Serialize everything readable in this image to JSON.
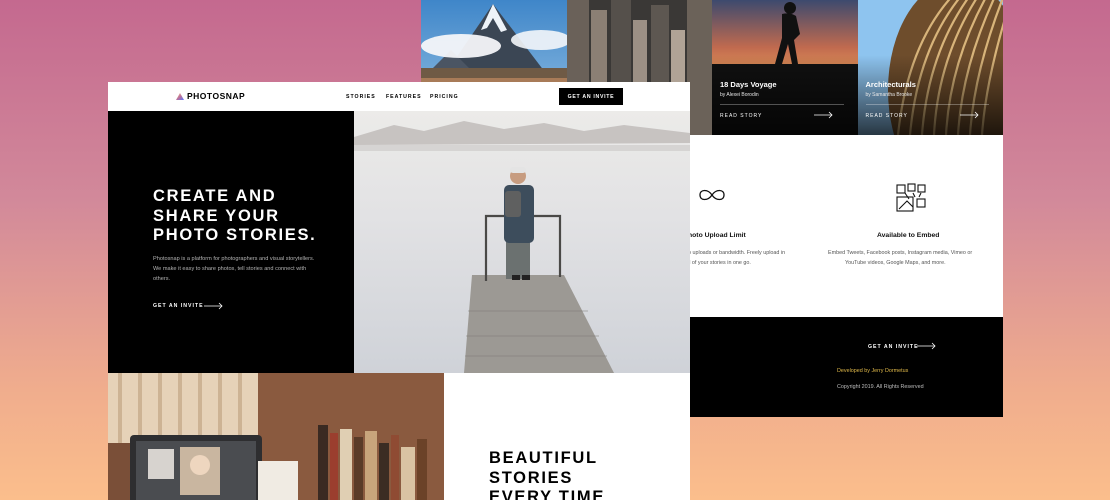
{
  "colors": {
    "accent_gradient": [
      "#ffc593",
      "#bc7198",
      "#5a77ff"
    ],
    "footer_link": "#e0b94a"
  },
  "nav": {
    "brand": "PHOTOSNAP",
    "links": [
      "STORIES",
      "FEATURES",
      "PRICING"
    ],
    "cta": "GET AN INVITE"
  },
  "hero": {
    "heading_lines": [
      "CREATE AND",
      "SHARE YOUR",
      "PHOTO STORIES."
    ],
    "body": "Photosnap is a platform for photographers and visual storytellers. We make it easy to share photos, tell stories and connect with others.",
    "cta": "GET AN INVITE"
  },
  "second_section": {
    "heading_lines": [
      "BEAUTIFUL",
      "STORIES",
      "EVERY TIME"
    ]
  },
  "stories": [
    {
      "title": "18 Days Voyage",
      "author": "by Alexei Borodin",
      "cta": "READ STORY"
    },
    {
      "title": "Architecturals",
      "author": "by Samantha Brooke",
      "cta": "READ STORY"
    }
  ],
  "features": [
    {
      "icon": "infinity-icon",
      "title": "hoto Upload Limit",
      "desc_lines": [
        "o uploads or bandwidth. Freely upload in",
        "ll of your stories in one go."
      ]
    },
    {
      "icon": "embed-icon",
      "title": "Available to Embed",
      "desc_lines": [
        "Embed Tweets, Facebook posts, Instagram media, Vimeo or",
        "YouTube videos, Google Maps, and more."
      ]
    }
  ],
  "footer": {
    "cta": "GET AN INVITE",
    "credit": "Developed by Jerry Dormetus",
    "copyright": "Copyright 2019. All Rights Reserved"
  }
}
